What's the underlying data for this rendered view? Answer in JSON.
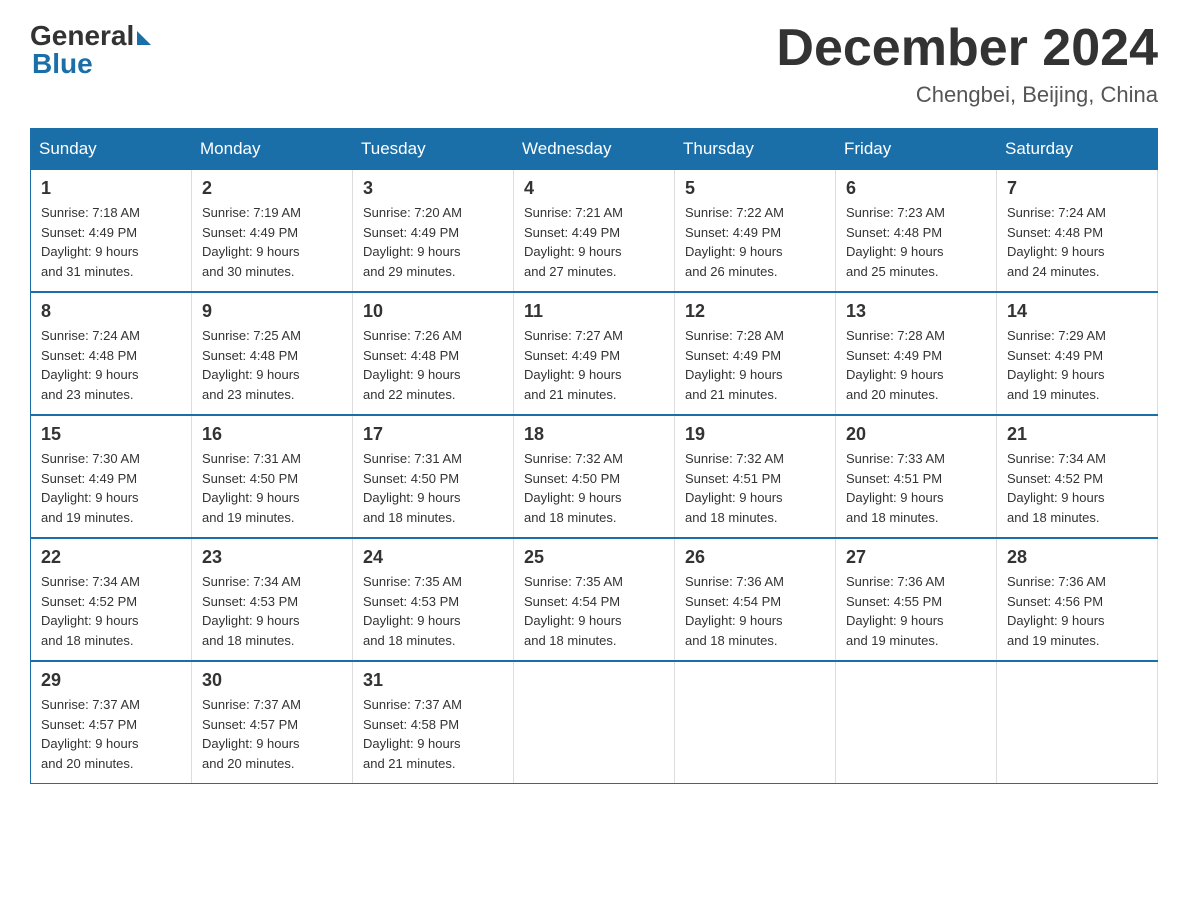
{
  "logo": {
    "general": "General",
    "blue": "Blue"
  },
  "header": {
    "month_year": "December 2024",
    "location": "Chengbei, Beijing, China"
  },
  "weekdays": [
    "Sunday",
    "Monday",
    "Tuesday",
    "Wednesday",
    "Thursday",
    "Friday",
    "Saturday"
  ],
  "weeks": [
    [
      {
        "day": "1",
        "sunrise": "7:18 AM",
        "sunset": "4:49 PM",
        "daylight": "9 hours and 31 minutes."
      },
      {
        "day": "2",
        "sunrise": "7:19 AM",
        "sunset": "4:49 PM",
        "daylight": "9 hours and 30 minutes."
      },
      {
        "day": "3",
        "sunrise": "7:20 AM",
        "sunset": "4:49 PM",
        "daylight": "9 hours and 29 minutes."
      },
      {
        "day": "4",
        "sunrise": "7:21 AM",
        "sunset": "4:49 PM",
        "daylight": "9 hours and 27 minutes."
      },
      {
        "day": "5",
        "sunrise": "7:22 AM",
        "sunset": "4:49 PM",
        "daylight": "9 hours and 26 minutes."
      },
      {
        "day": "6",
        "sunrise": "7:23 AM",
        "sunset": "4:48 PM",
        "daylight": "9 hours and 25 minutes."
      },
      {
        "day": "7",
        "sunrise": "7:24 AM",
        "sunset": "4:48 PM",
        "daylight": "9 hours and 24 minutes."
      }
    ],
    [
      {
        "day": "8",
        "sunrise": "7:24 AM",
        "sunset": "4:48 PM",
        "daylight": "9 hours and 23 minutes."
      },
      {
        "day": "9",
        "sunrise": "7:25 AM",
        "sunset": "4:48 PM",
        "daylight": "9 hours and 23 minutes."
      },
      {
        "day": "10",
        "sunrise": "7:26 AM",
        "sunset": "4:48 PM",
        "daylight": "9 hours and 22 minutes."
      },
      {
        "day": "11",
        "sunrise": "7:27 AM",
        "sunset": "4:49 PM",
        "daylight": "9 hours and 21 minutes."
      },
      {
        "day": "12",
        "sunrise": "7:28 AM",
        "sunset": "4:49 PM",
        "daylight": "9 hours and 21 minutes."
      },
      {
        "day": "13",
        "sunrise": "7:28 AM",
        "sunset": "4:49 PM",
        "daylight": "9 hours and 20 minutes."
      },
      {
        "day": "14",
        "sunrise": "7:29 AM",
        "sunset": "4:49 PM",
        "daylight": "9 hours and 19 minutes."
      }
    ],
    [
      {
        "day": "15",
        "sunrise": "7:30 AM",
        "sunset": "4:49 PM",
        "daylight": "9 hours and 19 minutes."
      },
      {
        "day": "16",
        "sunrise": "7:31 AM",
        "sunset": "4:50 PM",
        "daylight": "9 hours and 19 minutes."
      },
      {
        "day": "17",
        "sunrise": "7:31 AM",
        "sunset": "4:50 PM",
        "daylight": "9 hours and 18 minutes."
      },
      {
        "day": "18",
        "sunrise": "7:32 AM",
        "sunset": "4:50 PM",
        "daylight": "9 hours and 18 minutes."
      },
      {
        "day": "19",
        "sunrise": "7:32 AM",
        "sunset": "4:51 PM",
        "daylight": "9 hours and 18 minutes."
      },
      {
        "day": "20",
        "sunrise": "7:33 AM",
        "sunset": "4:51 PM",
        "daylight": "9 hours and 18 minutes."
      },
      {
        "day": "21",
        "sunrise": "7:34 AM",
        "sunset": "4:52 PM",
        "daylight": "9 hours and 18 minutes."
      }
    ],
    [
      {
        "day": "22",
        "sunrise": "7:34 AM",
        "sunset": "4:52 PM",
        "daylight": "9 hours and 18 minutes."
      },
      {
        "day": "23",
        "sunrise": "7:34 AM",
        "sunset": "4:53 PM",
        "daylight": "9 hours and 18 minutes."
      },
      {
        "day": "24",
        "sunrise": "7:35 AM",
        "sunset": "4:53 PM",
        "daylight": "9 hours and 18 minutes."
      },
      {
        "day": "25",
        "sunrise": "7:35 AM",
        "sunset": "4:54 PM",
        "daylight": "9 hours and 18 minutes."
      },
      {
        "day": "26",
        "sunrise": "7:36 AM",
        "sunset": "4:54 PM",
        "daylight": "9 hours and 18 minutes."
      },
      {
        "day": "27",
        "sunrise": "7:36 AM",
        "sunset": "4:55 PM",
        "daylight": "9 hours and 19 minutes."
      },
      {
        "day": "28",
        "sunrise": "7:36 AM",
        "sunset": "4:56 PM",
        "daylight": "9 hours and 19 minutes."
      }
    ],
    [
      {
        "day": "29",
        "sunrise": "7:37 AM",
        "sunset": "4:57 PM",
        "daylight": "9 hours and 20 minutes."
      },
      {
        "day": "30",
        "sunrise": "7:37 AM",
        "sunset": "4:57 PM",
        "daylight": "9 hours and 20 minutes."
      },
      {
        "day": "31",
        "sunrise": "7:37 AM",
        "sunset": "4:58 PM",
        "daylight": "9 hours and 21 minutes."
      },
      null,
      null,
      null,
      null
    ]
  ],
  "labels": {
    "sunrise": "Sunrise:",
    "sunset": "Sunset:",
    "daylight": "Daylight:"
  }
}
